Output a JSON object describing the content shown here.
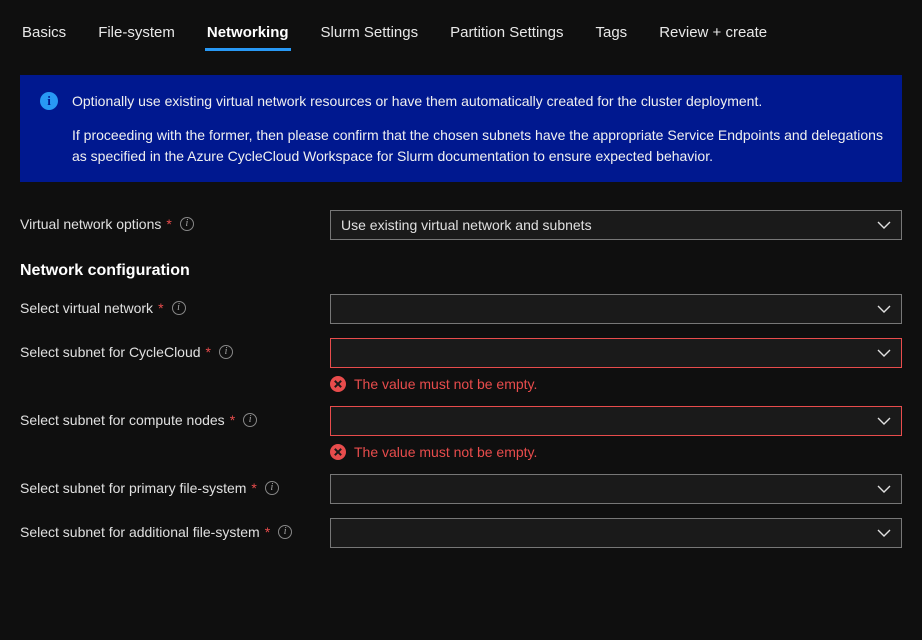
{
  "tabs": {
    "items": [
      {
        "label": "Basics"
      },
      {
        "label": "File-system"
      },
      {
        "label": "Networking",
        "active": true
      },
      {
        "label": "Slurm Settings"
      },
      {
        "label": "Partition Settings"
      },
      {
        "label": "Tags"
      },
      {
        "label": "Review + create"
      }
    ]
  },
  "banner": {
    "line1": "Optionally use existing virtual network resources or have them automatically created for the cluster deployment.",
    "line2": "If proceeding with the former, then please confirm that the chosen subnets have the appropriate Service Endpoints and delegations as specified in the Azure CycleCloud Workspace for Slurm documentation to ensure expected behavior."
  },
  "form": {
    "vnet_options": {
      "label": "Virtual network options",
      "value": "Use existing virtual network and subnets"
    },
    "section_title": "Network configuration",
    "select_vnet": {
      "label": "Select virtual network",
      "value": ""
    },
    "subnet_cc": {
      "label": "Select subnet for CycleCloud",
      "value": "",
      "error": "The value must not be empty."
    },
    "subnet_compute": {
      "label": "Select subnet for compute nodes",
      "value": "",
      "error": "The value must not be empty."
    },
    "subnet_primary_fs": {
      "label": "Select subnet for primary file-system",
      "value": ""
    },
    "subnet_additional_fs": {
      "label": "Select subnet for additional file-system",
      "value": ""
    }
  }
}
